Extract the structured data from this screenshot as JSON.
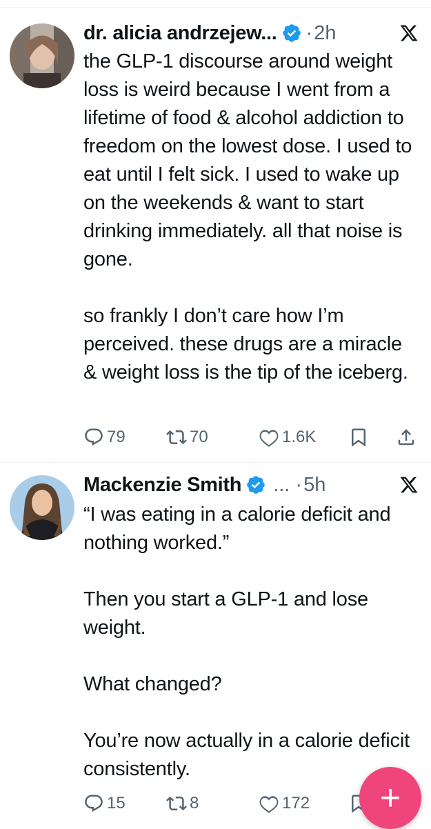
{
  "tweets": [
    {
      "author": "dr. alicia andrzejew...",
      "dot": "·",
      "time": "2h",
      "text": "the GLP-1 discourse around weight loss is weird because I went from a lifetime of food & alcohol addiction to freedom on the lowest dose. I used to eat until I felt sick. I used to wake up on the weekends & want to start drinking immediately. all that noise is gone.\n\nso frankly I don’t care how I’m perceived. these drugs are a miracle & weight loss is the tip of the iceberg.",
      "replies": "79",
      "reposts": "70",
      "likes": "1.6K"
    },
    {
      "author": "Mackenzie Smith",
      "dot": "... ·",
      "time": "5h",
      "text": "“I was eating in a calorie deficit and nothing worked.”\n\nThen you start a GLP-1 and lose weight.\n\nWhat changed?\n\nYou’re now actually in a calorie deficit consistently.",
      "replies": "15",
      "reposts": "8",
      "likes": "172"
    }
  ],
  "icons": {
    "reply": "reply-icon",
    "repost": "repost-icon",
    "like": "heart-icon",
    "bookmark": "bookmark-icon",
    "share": "share-icon",
    "platform": "x-logo-icon",
    "verified": "verified-badge-icon",
    "compose": "plus-icon"
  },
  "fab": {
    "label": "+"
  },
  "colors": {
    "verified": "#1d9bf0",
    "fab": "#f0447c",
    "secondary_text": "#536471"
  }
}
